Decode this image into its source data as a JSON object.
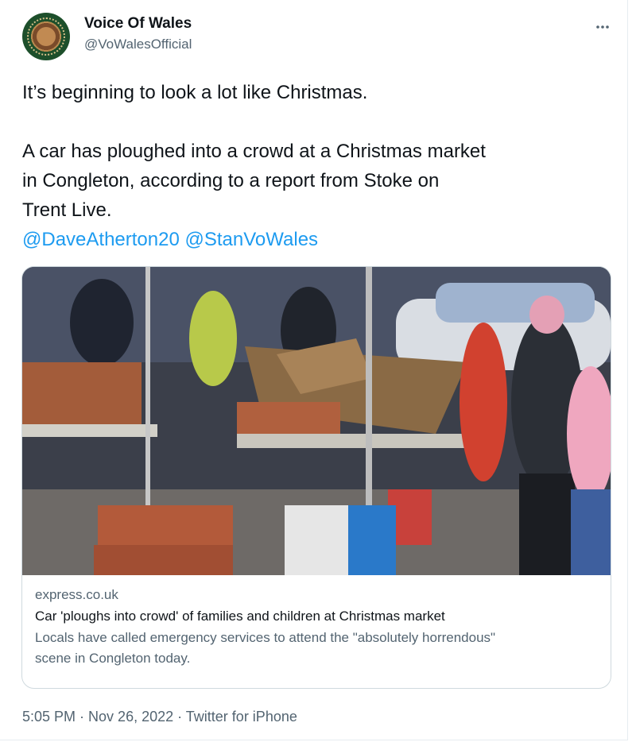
{
  "author": {
    "display_name": "Voice Of Wales",
    "handle": "@VoWalesOfficial"
  },
  "tweet": {
    "line1": "It’s beginning to look a lot like Christmas.",
    "paragraph2_lines": [
      "A car has ploughed into a crowd at a Christmas market",
      "in Congleton, according to a report from Stoke on",
      "Trent Live."
    ],
    "mentions": [
      "@DaveAtherton20",
      "@StanVoWales"
    ]
  },
  "link_card": {
    "domain": "express.co.uk",
    "title": "Car 'ploughs into crowd' of families and children at Christmas market",
    "description_lines": [
      "Locals have called emergency services to attend the \"absolutely horrendous\"",
      "scene in Congleton today."
    ]
  },
  "footer": {
    "time": "5:05 PM",
    "separator": " · ",
    "date": "Nov 26, 2022",
    "client": "Twitter for iPhone"
  },
  "colors": {
    "link_blue": "#1d9bf0",
    "secondary_text": "#536471",
    "border": "#cfd9de"
  },
  "icons": [
    "more-options-icon"
  ]
}
